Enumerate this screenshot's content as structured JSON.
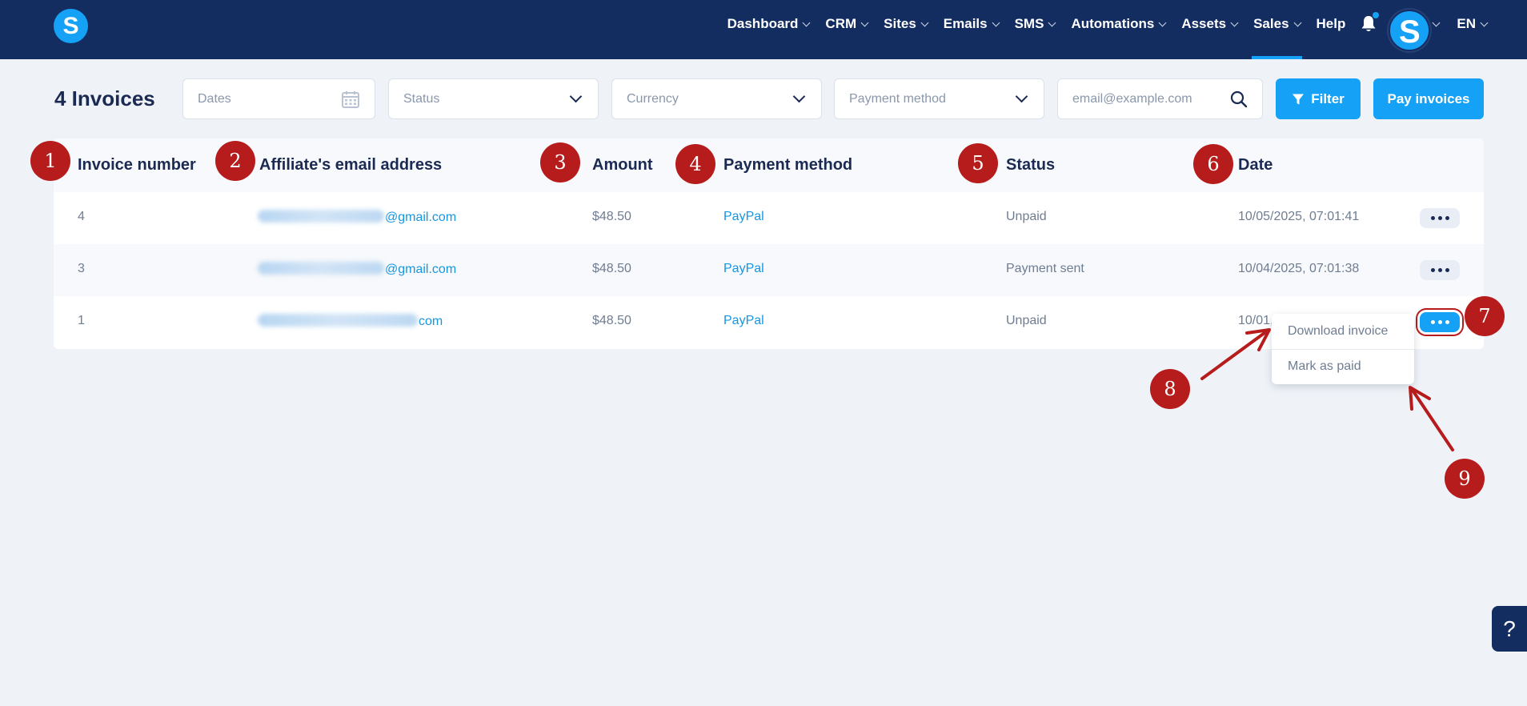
{
  "nav": {
    "logo_letter": "S",
    "items": [
      {
        "label": "Dashboard"
      },
      {
        "label": "CRM"
      },
      {
        "label": "Sites"
      },
      {
        "label": "Emails"
      },
      {
        "label": "SMS"
      },
      {
        "label": "Automations"
      },
      {
        "label": "Assets"
      },
      {
        "label": "Sales"
      }
    ],
    "help_label": "Help",
    "avatar_letter": "S",
    "language": "EN",
    "accent_color": "#15a1f5",
    "bar_color": "#142d61"
  },
  "toolbar": {
    "title": "4 Invoices",
    "dates_placeholder": "Dates",
    "status_placeholder": "Status",
    "currency_placeholder": "Currency",
    "payment_method_placeholder": "Payment method",
    "email_placeholder": "email@example.com",
    "filter_label": "Filter",
    "pay_invoices_label": "Pay invoices"
  },
  "table": {
    "headers": {
      "invoice_number": "Invoice number",
      "email": "Affiliate's email address",
      "amount": "Amount",
      "payment_method": "Payment method",
      "status": "Status",
      "date": "Date"
    },
    "rows": [
      {
        "number": "4",
        "email_suffix": "@gmail.com",
        "amount": "$48.50",
        "method": "PayPal",
        "status": "Unpaid",
        "date": "10/05/2025, 07:01:41"
      },
      {
        "number": "3",
        "email_suffix": "@gmail.com",
        "amount": "$48.50",
        "method": "PayPal",
        "status": "Payment sent",
        "date": "10/04/2025, 07:01:38"
      },
      {
        "number": "1",
        "email_suffix": "com",
        "amount": "$48.50",
        "method": "PayPal",
        "status": "Unpaid",
        "date": "10/01,"
      }
    ]
  },
  "menu": {
    "download_label": "Download invoice",
    "mark_paid_label": "Mark as paid"
  },
  "annotations": {
    "badges": [
      "1",
      "2",
      "3",
      "4",
      "5",
      "6",
      "7",
      "8",
      "9"
    ],
    "color": "#b71c1c"
  },
  "help_tab": "?"
}
